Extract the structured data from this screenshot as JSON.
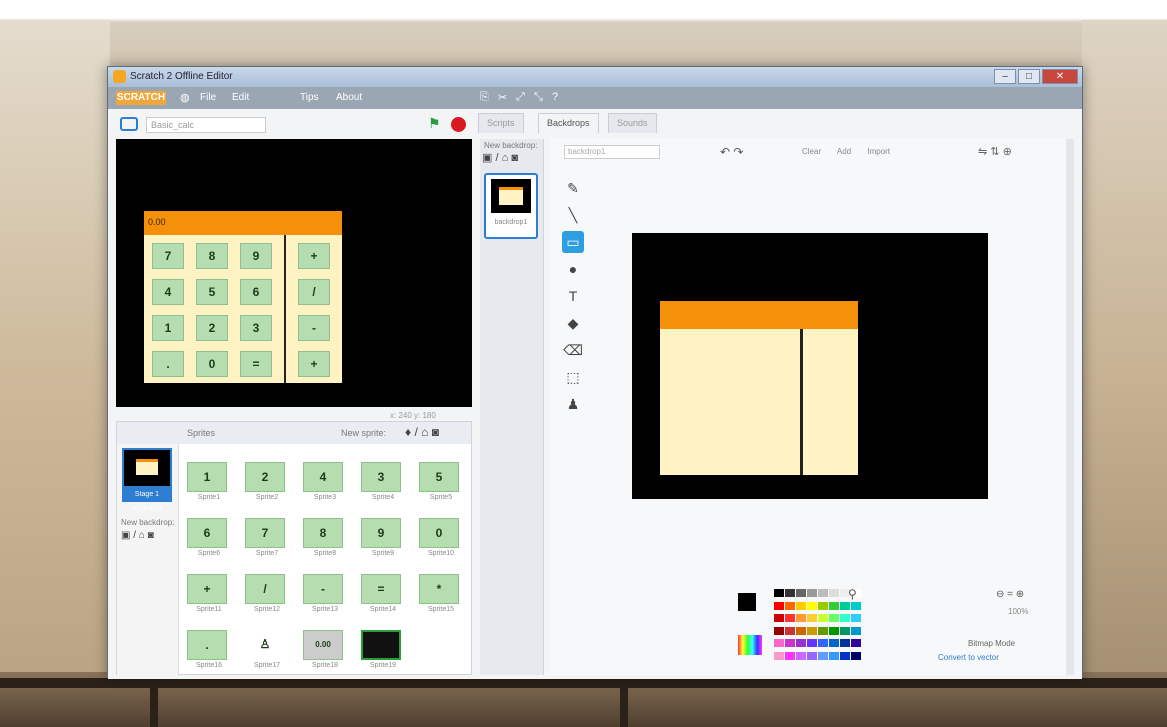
{
  "window": {
    "title": "Scratch 2 Offline Editor",
    "menu": [
      "File",
      "Edit",
      "Tips",
      "About"
    ]
  },
  "stage_header": {
    "project_name": "Basic_calc"
  },
  "calculator": {
    "display": "0.00",
    "keys": [
      "7",
      "8",
      "9",
      "+",
      "4",
      "5",
      "6",
      "/",
      "1",
      "2",
      "3",
      "-",
      ".",
      "0",
      "=",
      "+"
    ]
  },
  "stage_tools": "x: 240  y: 180",
  "sprites_panel": {
    "label": "Sprites",
    "new_sprite_label": "New sprite:",
    "stage_caption": "Stage 1 backdrop",
    "new_backdrop_label": "New backdrop:",
    "sprites": [
      {
        "label": "1",
        "name": "Sprite1"
      },
      {
        "label": "2",
        "name": "Sprite2"
      },
      {
        "label": "4",
        "name": "Sprite3"
      },
      {
        "label": "3",
        "name": "Sprite4"
      },
      {
        "label": "5",
        "name": "Sprite5"
      },
      {
        "label": "6",
        "name": "Sprite6"
      },
      {
        "label": "7",
        "name": "Sprite7"
      },
      {
        "label": "8",
        "name": "Sprite8"
      },
      {
        "label": "9",
        "name": "Sprite9"
      },
      {
        "label": "0",
        "name": "Sprite10"
      },
      {
        "label": "+",
        "name": "Sprite11"
      },
      {
        "label": "/",
        "name": "Sprite12"
      },
      {
        "label": "-",
        "name": "Sprite13"
      },
      {
        "label": "=",
        "name": "Sprite14"
      },
      {
        "label": "*",
        "name": "Sprite15"
      },
      {
        "label": ".",
        "name": "Sprite16"
      },
      {
        "label": "",
        "name": "Sprite17"
      },
      {
        "label": "0.00",
        "name": "Sprite18"
      },
      {
        "label": "",
        "name": "Sprite19"
      }
    ]
  },
  "editor": {
    "tabs": [
      "Scripts",
      "Backdrops",
      "Sounds"
    ],
    "new_costume_label": "New backdrop:",
    "costume_caption": "backdrop1",
    "costume_name": "backdrop1",
    "actions": "Clear Add Import",
    "zoom_label": "100%",
    "mode_label": "Bitmap Mode",
    "convert_label": "Convert to vector"
  },
  "colors": {
    "accent": "#2d7dd2",
    "display": "#f5900a",
    "body": "#fff3c4",
    "key": "#b6ddb0",
    "stop": "#d71920",
    "flag": "#2a9d3a"
  },
  "palette": [
    "#000000",
    "#333333",
    "#666666",
    "#999999",
    "#bbbbbb",
    "#dddddd",
    "#eeeeee",
    "#ffffff",
    "#ff0000",
    "#ff6600",
    "#ffcc00",
    "#ffff00",
    "#99cc00",
    "#33cc33",
    "#00cc99",
    "#00cccc",
    "#cc0000",
    "#ff3333",
    "#ff9933",
    "#ffcc33",
    "#ccff33",
    "#66ff66",
    "#33ffcc",
    "#33ccff",
    "#990000",
    "#cc3333",
    "#cc6600",
    "#cc9900",
    "#669900",
    "#009900",
    "#009966",
    "#0099cc",
    "#ff66cc",
    "#cc33cc",
    "#9933cc",
    "#6633ff",
    "#3366ff",
    "#0066cc",
    "#003399",
    "#330099",
    "#ff99cc",
    "#ff33ff",
    "#cc66ff",
    "#9966ff",
    "#6699ff",
    "#3399ff",
    "#0033cc",
    "#000066"
  ]
}
